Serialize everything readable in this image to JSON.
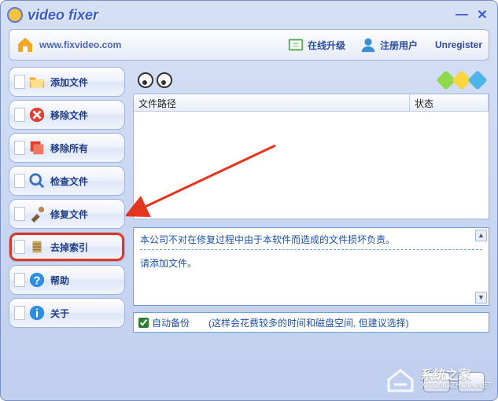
{
  "titlebar": {
    "title": "video fixer"
  },
  "toolbar": {
    "url": "www.fixvideo.com",
    "upgrade_label": "在线升级",
    "register_label": "注册用户",
    "unregister_label": "Unregister"
  },
  "sidebar": {
    "items": [
      {
        "label": "添加文件",
        "name": "add-file",
        "icon": "folder-add"
      },
      {
        "label": "移除文件",
        "name": "remove-file",
        "icon": "remove-x"
      },
      {
        "label": "移除所有",
        "name": "remove-all",
        "icon": "remove-all"
      },
      {
        "label": "检查文件",
        "name": "check-file",
        "icon": "magnify"
      },
      {
        "label": "修复文件",
        "name": "repair-file",
        "icon": "tools"
      },
      {
        "label": "去掉索引",
        "name": "remove-index",
        "icon": "clip",
        "highlight": true
      },
      {
        "label": "帮助",
        "name": "help",
        "icon": "help"
      },
      {
        "label": "关于",
        "name": "about",
        "icon": "info"
      }
    ]
  },
  "table": {
    "columns": {
      "path": "文件路径",
      "status": "状态"
    },
    "rows": []
  },
  "log": {
    "line1": "本公司不对在修复过程中由于本软件而造成的文件损坏负责。",
    "line2": "请添加文件。"
  },
  "backup": {
    "checked": true,
    "label": "自动备份",
    "hint": "(这样会花费较多的时间和磁盘空间, 但建议选择)"
  },
  "watermark": {
    "title": "系统之家",
    "sub": "XITONGZHIJIA.NET"
  },
  "icon_colors": {
    "folder": "#f5a623",
    "remove": "#e04030",
    "help": "#2e8fe0",
    "info": "#2e8fe0",
    "tools": "#7a5c3a",
    "magnify": "#3a6fb8"
  }
}
